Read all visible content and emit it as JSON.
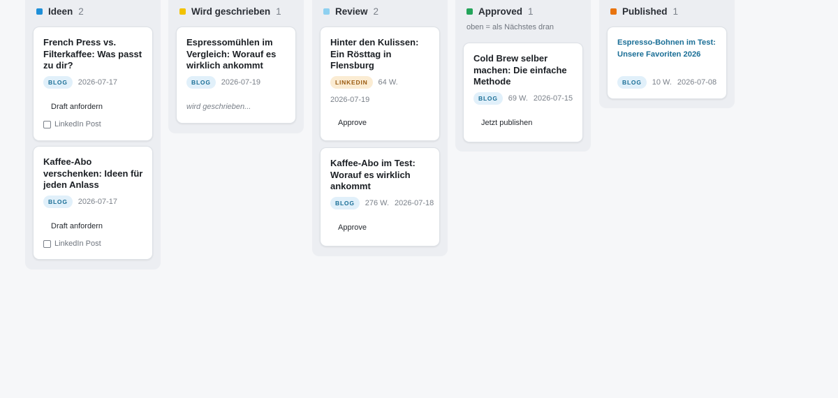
{
  "columns": [
    {
      "title": "Ideen",
      "count": "2",
      "color": "#1e8fd8",
      "cards": [
        {
          "title": "French Press vs. Filterkaffee: Was passt zu dir?",
          "badge": "BLOG",
          "date": "2026-07-17",
          "action": "Draft anfordern",
          "checkbox_label": "LinkedIn Post"
        },
        {
          "title": "Kaffee-Abo verschenken: Ideen für jeden Anlass",
          "badge": "BLOG",
          "date": "2026-07-17",
          "action": "Draft anfordern",
          "checkbox_label": "LinkedIn Post"
        }
      ]
    },
    {
      "title": "Wird geschrieben",
      "count": "1",
      "color": "#f2c200",
      "cards": [
        {
          "title": "Espressomühlen im Vergleich: Worauf es wirklich ankommt",
          "badge": "BLOG",
          "date": "2026-07-19",
          "status": "wird geschrieben..."
        }
      ]
    },
    {
      "title": "Review",
      "count": "2",
      "color": "#8ed0f0",
      "cards": [
        {
          "title": "Hinter den Kulissen: Ein Rösttag in Flensburg",
          "badge": "LINKEDIN",
          "words": "64 W.",
          "date": "2026-07-19",
          "action": "Approve"
        },
        {
          "title": "Kaffee-Abo im Test: Worauf es wirklich ankommt",
          "badge": "BLOG",
          "words": "276 W.",
          "date": "2026-07-18",
          "action": "Approve"
        }
      ]
    },
    {
      "title": "Approved",
      "count": "1",
      "color": "#23a45a",
      "subtitle": "oben = als Nächstes dran",
      "cards": [
        {
          "title": "Cold Brew selber machen: Die einfache Methode",
          "badge": "BLOG",
          "words": "69 W.",
          "date": "2026-07-15",
          "action": "Jetzt publishen"
        }
      ]
    },
    {
      "title": "Published",
      "count": "1",
      "color": "#e8740f",
      "cards": [
        {
          "title": "Espresso-Bohnen im Test: Unsere Favoriten 2026",
          "badge": "BLOG",
          "words": "10 W.",
          "date": "2026-07-08"
        }
      ]
    }
  ]
}
